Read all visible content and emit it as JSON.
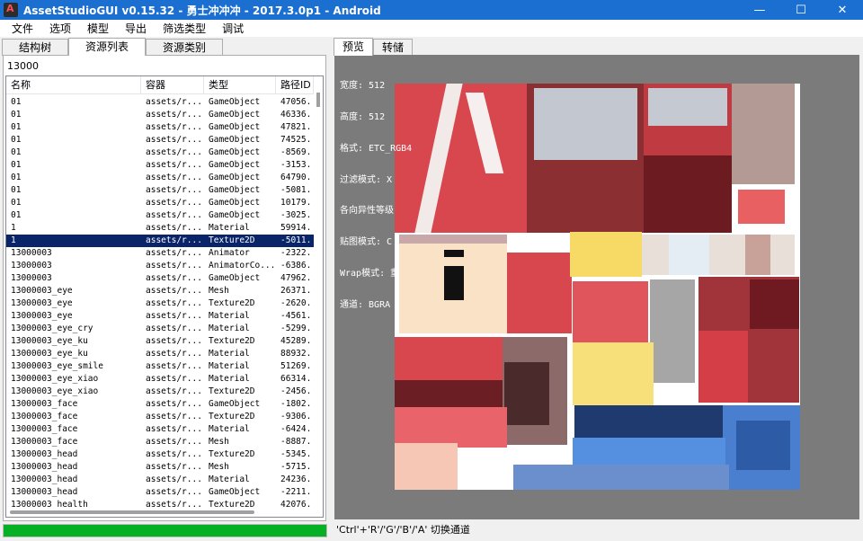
{
  "window": {
    "title": "AssetStudioGUI v0.15.32 - 勇士冲冲冲 - 2017.3.0p1 - Android",
    "min_glyph": "—",
    "max_glyph": "☐",
    "close_glyph": "✕"
  },
  "menu": [
    "文件",
    "选项",
    "模型",
    "导出",
    "筛选类型",
    "调试"
  ],
  "left_tabs": [
    "结构树",
    "资源列表",
    "资源类别"
  ],
  "filter_text": "13000",
  "list": {
    "headers": [
      "名称",
      "容器",
      "类型",
      "路径ID"
    ],
    "rows": [
      [
        "01",
        "assets/r...",
        "GameObject",
        "47056."
      ],
      [
        "01",
        "assets/r...",
        "GameObject",
        "46336."
      ],
      [
        "01",
        "assets/r...",
        "GameObject",
        "47821."
      ],
      [
        "01",
        "assets/r...",
        "GameObject",
        "74525."
      ],
      [
        "01",
        "assets/r...",
        "GameObject",
        "-8569."
      ],
      [
        "01",
        "assets/r...",
        "GameObject",
        "-3153."
      ],
      [
        "01",
        "assets/r...",
        "GameObject",
        "64790."
      ],
      [
        "01",
        "assets/r...",
        "GameObject",
        "-5081."
      ],
      [
        "01",
        "assets/r...",
        "GameObject",
        "10179."
      ],
      [
        "01",
        "assets/r...",
        "GameObject",
        "-3025."
      ],
      [
        "1",
        "assets/r...",
        "Material",
        "59914."
      ],
      [
        "1",
        "assets/r...",
        "Texture2D",
        "-5011."
      ],
      [
        "13000003",
        "assets/r...",
        "Animator",
        "-2322."
      ],
      [
        "13000003",
        "assets/r...",
        "AnimatorCo...",
        "-6386."
      ],
      [
        "13000003",
        "assets/r...",
        "GameObject",
        "47962."
      ],
      [
        "13000003_eye",
        "assets/r...",
        "Mesh",
        "26371."
      ],
      [
        "13000003_eye",
        "assets/r...",
        "Texture2D",
        "-2620."
      ],
      [
        "13000003_eye",
        "assets/r...",
        "Material",
        "-4561."
      ],
      [
        "13000003_eye_cry",
        "assets/r...",
        "Material",
        "-5299."
      ],
      [
        "13000003_eye_ku",
        "assets/r...",
        "Texture2D",
        "45289."
      ],
      [
        "13000003_eye_ku",
        "assets/r...",
        "Material",
        "88932."
      ],
      [
        "13000003_eye_smile",
        "assets/r...",
        "Material",
        "51269."
      ],
      [
        "13000003_eye_xiao",
        "assets/r...",
        "Material",
        "66314."
      ],
      [
        "13000003_eye_xiao",
        "assets/r...",
        "Texture2D",
        "-2456."
      ],
      [
        "13000003_face",
        "assets/r...",
        "GameObject",
        "-1802."
      ],
      [
        "13000003_face",
        "assets/r...",
        "Texture2D",
        "-9306."
      ],
      [
        "13000003_face",
        "assets/r...",
        "Material",
        "-6424."
      ],
      [
        "13000003_face",
        "assets/r...",
        "Mesh",
        "-8887."
      ],
      [
        "13000003_head",
        "assets/r...",
        "Texture2D",
        "-5345."
      ],
      [
        "13000003_head",
        "assets/r...",
        "Mesh",
        "-5715."
      ],
      [
        "13000003_head",
        "assets/r...",
        "Material",
        "24236."
      ],
      [
        "13000003_head",
        "assets/r...",
        "GameObject",
        "-2211."
      ],
      [
        "13000003_health",
        "assets/r...",
        "Texture2D",
        "42076."
      ]
    ],
    "selected_index": 11
  },
  "right_tabs": [
    "预览",
    "转储"
  ],
  "texture_info": [
    "宽度: 512",
    "高度: 512",
    "格式: ETC_RGB4",
    "过滤模式: X",
    "各向异性等级",
    "贴图模式: C",
    "Wrap模式: 重",
    "通道: BGRA"
  ],
  "status_hint": "'Ctrl'+'R'/'G'/'B'/'A' 切换通道",
  "progress_fraction": 1.0,
  "colors": {
    "title_bar": "#1a6fd1",
    "selection": "#0a246a",
    "progress": "#06b025",
    "preview_bg": "#7b7b7b"
  },
  "icons": {
    "app": "app-logo-icon",
    "minimize": "minimize-icon",
    "maximize": "maximize-icon",
    "close": "close-icon"
  }
}
